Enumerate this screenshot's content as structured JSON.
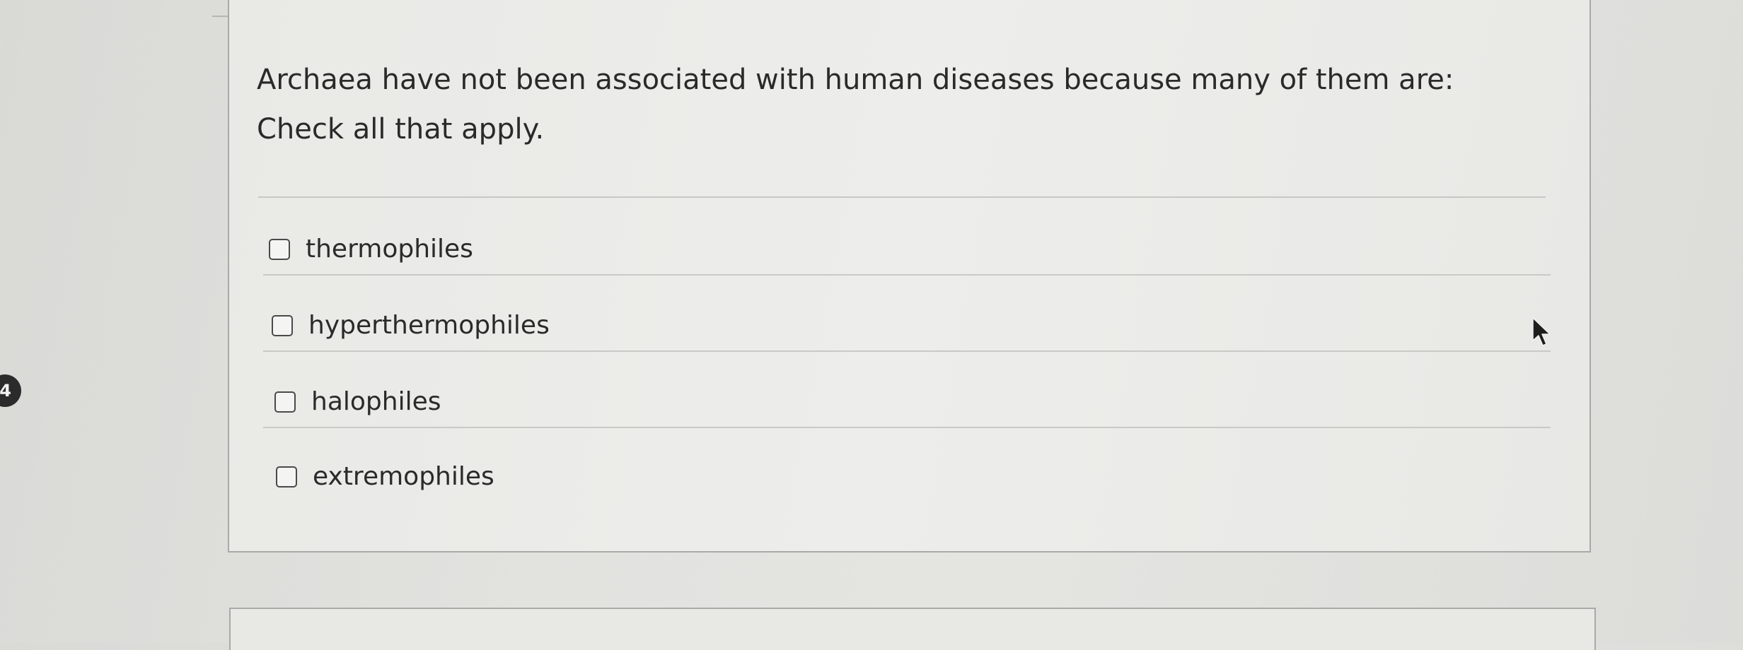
{
  "question": {
    "number": "4",
    "text": "Archaea have not been associated with human diseases because many of them are: Check all that apply."
  },
  "options": [
    {
      "label": "thermophiles",
      "checked": false
    },
    {
      "label": "hyperthermophiles",
      "checked": false
    },
    {
      "label": "halophiles",
      "checked": false
    },
    {
      "label": "extremophiles",
      "checked": false
    }
  ],
  "icons": {
    "cursor": "mouse-pointer-arrow-icon",
    "checkbox": "checkbox-unchecked-icon"
  },
  "colors": {
    "text": "#2a2a2a",
    "border": "#a9aaa7",
    "background": "#e2e2df"
  }
}
